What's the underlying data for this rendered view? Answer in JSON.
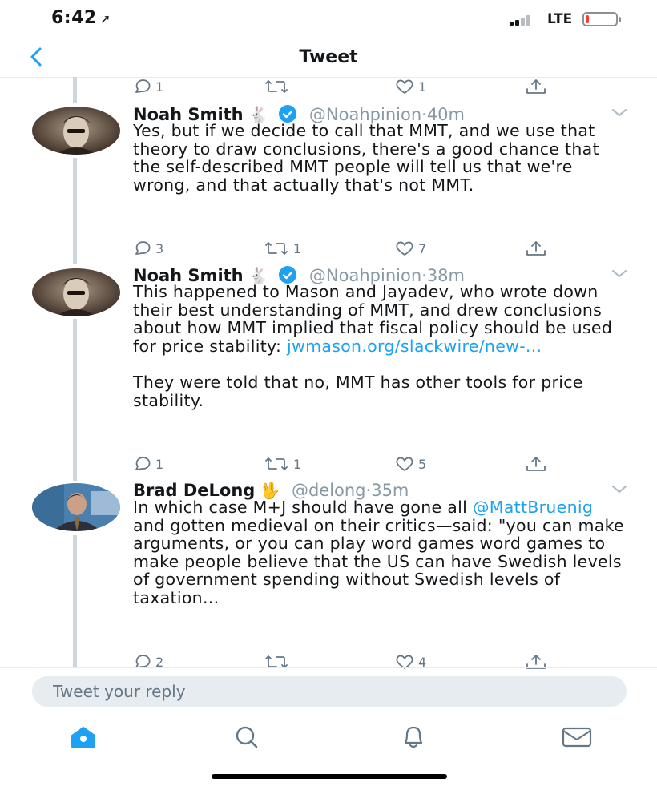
{
  "status_bar": {
    "time": "6:42",
    "network": "LTE",
    "battery_level": 0.1,
    "battery_color": "#ff3b30"
  },
  "nav": {
    "title": "Tweet",
    "back_icon": "chevron-left-icon"
  },
  "thread_top_actions": {
    "replies": "1",
    "retweets": "",
    "likes": "1"
  },
  "tweets": [
    {
      "name": "Noah Smith",
      "emoji": "🐇",
      "verified": true,
      "handle": "@Noahpinion",
      "separator": "·",
      "time": "40m",
      "text": "Yes, but if we decide to call that MMT, and we use that theory to draw conclusions, there's a good chance that the self-described MMT people will tell us that we're wrong, and that actually that's not MMT.",
      "replies": "3",
      "retweets": "1",
      "likes": "7"
    },
    {
      "name": "Noah Smith",
      "emoji": "🐇",
      "verified": true,
      "handle": "@Noahpinion",
      "separator": "·",
      "time": "38m",
      "text_part1": "This happened to Mason and Jayadev, who wrote down their best understanding of MMT, and drew conclusions about how MMT implied that fiscal policy should be used for price stability: ",
      "link": "jwmason.org/slackwire/new-...",
      "text_part2": "They were told that no, MMT has other tools for price stability.",
      "replies": "1",
      "retweets": "1",
      "likes": "5"
    },
    {
      "name": "Brad DeLong",
      "emoji": "🖖",
      "verified": false,
      "handle": "@delong",
      "separator": "·",
      "time": "35m",
      "text_part1": "In which case M+J should have gone all ",
      "mention": "@MattBruenig",
      "text_part2": " and gotten medieval on their critics—said: \"you can make arguments, or you can play word games word games to make people believe that the US can have Swedish levels of government spending without Swedish levels of taxation...",
      "replies": "2",
      "retweets": "",
      "likes": "4"
    }
  ],
  "reply": {
    "placeholder": "Tweet your reply"
  },
  "tabbar": {
    "items": [
      "home-icon",
      "search-icon",
      "notifications-icon",
      "messages-icon"
    ],
    "active": "home-icon"
  },
  "colors": {
    "accent": "#1da1f2",
    "muted": "#8899a6",
    "thread_line": "#ccd6dd",
    "battery_low": "#ff3b30"
  }
}
